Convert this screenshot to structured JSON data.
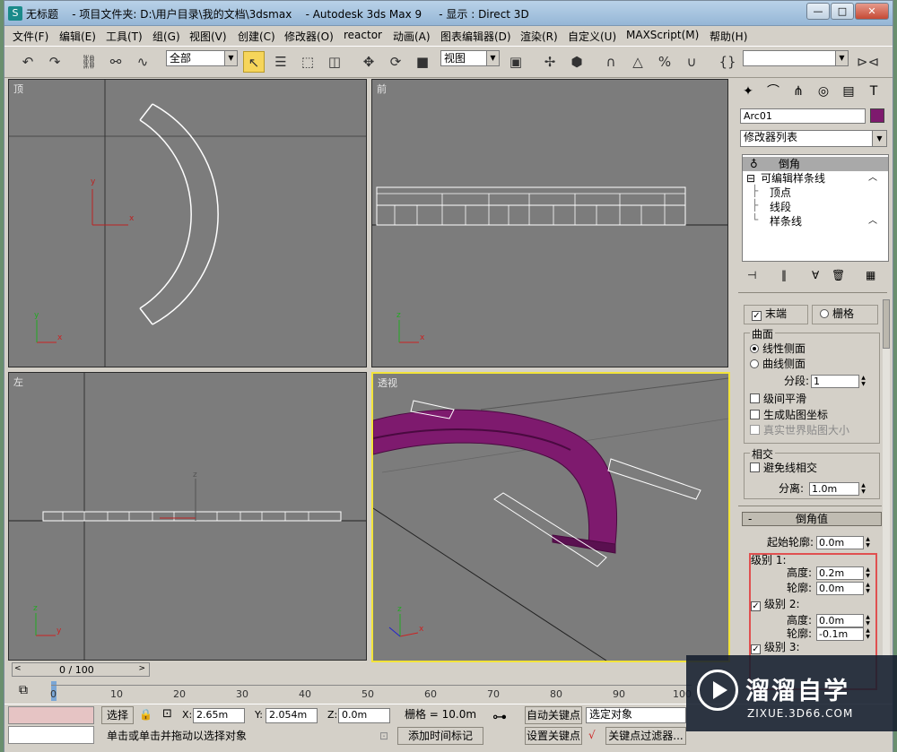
{
  "window": {
    "title": "无标题    - 项目文件夹: D:\\用户目录\\我的文档\\3dsmax    - Autodesk 3ds Max 9     - 显示 : Direct 3D",
    "icon": "app-logo-icon",
    "controls": {
      "minimize": "—",
      "maximize": "□",
      "close": "✕"
    }
  },
  "menu": [
    "文件(F)",
    "编辑(E)",
    "工具(T)",
    "组(G)",
    "视图(V)",
    "创建(C)",
    "修改器(O)",
    "reactor",
    "动画(A)",
    "图表编辑器(D)",
    "渲染(R)",
    "自定义(U)",
    "MAXScript(M)",
    "帮助(H)"
  ],
  "toolbar": {
    "selection_filter": "全部",
    "reference_coord": "视图",
    "named_selection": ""
  },
  "viewports": {
    "top": "顶",
    "front": "前",
    "left": "左",
    "perspective": "透视"
  },
  "axis": {
    "x": "x",
    "y": "y",
    "z": "z"
  },
  "command_panel": {
    "object_name": "Arc01",
    "object_color": "#7e1a6e",
    "modifier_list": "修改器列表",
    "stack": [
      {
        "label": "倒角",
        "level": 0
      },
      {
        "label": "可编辑样条线",
        "level": 0
      },
      {
        "label": "顶点",
        "level": 1
      },
      {
        "label": "线段",
        "level": 1
      },
      {
        "label": "样条线",
        "level": 1
      }
    ],
    "caps": {
      "end": "末端",
      "end_checked": true,
      "grid": "栅格"
    },
    "surface": {
      "title": "曲面",
      "linear": "线性侧面",
      "curved": "曲线侧面",
      "segments_label": "分段:",
      "segments": "1",
      "smooth": "级间平滑",
      "gen_map": "生成贴图坐标",
      "real_world": "真实世界贴图大小"
    },
    "intersections": {
      "title": "相交",
      "keep_lines": "避免线相交",
      "separation_label": "分离:",
      "separation": "1.0m"
    },
    "bevel_values": {
      "title": "倒角值",
      "rollout_sign": "-",
      "start_outline_label": "起始轮廓:",
      "start_outline": "0.0m",
      "level1": {
        "label": "级别 1:",
        "height_label": "高度:",
        "height": "0.2m",
        "outline_label": "轮廓:",
        "outline": "0.0m"
      },
      "level2": {
        "label": "级别 2:",
        "checked": true,
        "height_label": "高度:",
        "height": "0.0m",
        "outline_label": "轮廓:",
        "outline": "-0.1m"
      },
      "level3": {
        "label": "级别 3:",
        "checked": true
      }
    }
  },
  "timeline": {
    "frame": "0 / 100",
    "ticks": [
      "0",
      "10",
      "20",
      "30",
      "40",
      "50",
      "60",
      "70",
      "80",
      "90",
      "100"
    ]
  },
  "status": {
    "mode": "选择",
    "x_label": "X:",
    "x": "2.65m",
    "y_label": "Y:",
    "y": "2.054m",
    "z_label": "Z:",
    "z": "0.0m",
    "grid": "栅格 = 10.0m",
    "prompt": "单击或单击并拖动以选择对象",
    "add_time_tag": "添加时间标记",
    "auto_key": "自动关键点",
    "selected": "选定对象",
    "set_key": "设置关键点",
    "key_filters": "关键点过滤器..."
  },
  "watermark": {
    "title": "溜溜自学",
    "subtitle": "ZIXUE.3D66.COM"
  }
}
